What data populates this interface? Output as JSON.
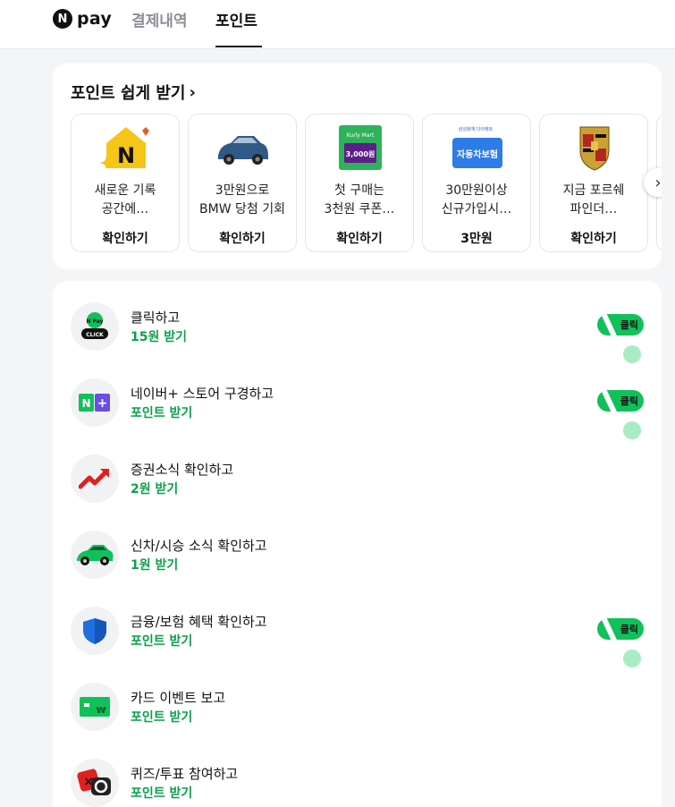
{
  "header": {
    "logo_badge": "N",
    "logo_text": "pay",
    "tabs": [
      {
        "label": "결제내역",
        "active": false
      },
      {
        "label": "포인트",
        "active": true
      }
    ]
  },
  "offers": {
    "title": "포인트 쉽게 받기",
    "chevron": "›",
    "items": [
      {
        "line1": "새로운 기록",
        "line2": "공간에…",
        "cta": "확인하기",
        "icon": "naver-n-icon"
      },
      {
        "line1": "3만원으로",
        "line2": "BMW 당첨 기회",
        "cta": "확인하기",
        "icon": "bmw-car-icon"
      },
      {
        "line1": "첫 구매는",
        "line2": "3천원 쿠폰…",
        "cta": "확인하기",
        "icon": "kurly-coupon-icon",
        "coupon_brand": "Kurly Mart",
        "coupon_amount": "3,000원"
      },
      {
        "line1": "30만원이상",
        "line2": "신규가입시…",
        "cta": "3만원",
        "icon": "insurance-icon",
        "insurance_brand": "삼성화재 다이렉트",
        "insurance_label": "자동차보험"
      },
      {
        "line1": "지금 포르쉐",
        "line2": "파인더…",
        "cta": "확인하기",
        "icon": "porsche-crest-icon"
      }
    ],
    "scroll_icon": "›"
  },
  "tasks": {
    "badge_label": "클릭",
    "items": [
      {
        "title": "클릭하고",
        "sub": "15원 받기",
        "icon": "npay-click-icon",
        "badge": true,
        "npay_label": "N Pay",
        "click_label": "CLICK"
      },
      {
        "title": "네이버+ 스토어 구경하고",
        "sub": "포인트 받기",
        "icon": "naver-plus-icon",
        "badge": true
      },
      {
        "title": "증권소식 확인하고",
        "sub": "2원 받기",
        "icon": "stock-up-arrow-icon",
        "badge": false
      },
      {
        "title": "신차/시승 소식 확인하고",
        "sub": "1원 받기",
        "icon": "green-car-icon",
        "badge": false
      },
      {
        "title": "금융/보험 혜택 확인하고",
        "sub": "포인트 받기",
        "icon": "shield-icon",
        "badge": true
      },
      {
        "title": "카드 이벤트 보고",
        "sub": "포인트 받기",
        "icon": "card-won-icon",
        "badge": false,
        "card_symbol": "₩"
      },
      {
        "title": "퀴즈/투표 참여하고",
        "sub": "포인트 받기",
        "icon": "quiz-vote-icon",
        "badge": false
      }
    ]
  },
  "colors": {
    "accent_green": "#0ba04c",
    "badge_green": "#10c15a",
    "background": "#f4f5f7"
  }
}
